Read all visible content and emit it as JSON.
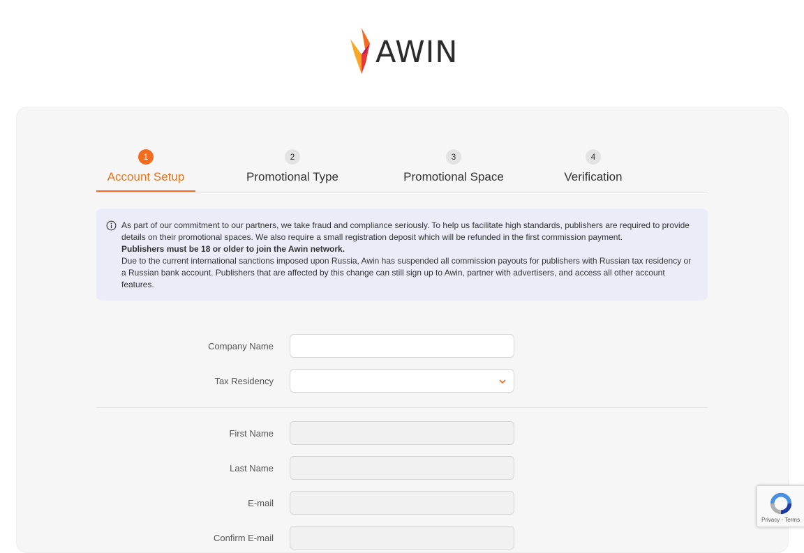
{
  "brand": {
    "name": "AWIN",
    "accent": "#f36d21"
  },
  "steps": [
    {
      "number": "1",
      "label": "Account Setup",
      "active": true
    },
    {
      "number": "2",
      "label": "Promotional Type",
      "active": false
    },
    {
      "number": "3",
      "label": "Promotional Space",
      "active": false
    },
    {
      "number": "4",
      "label": "Verification",
      "active": false
    }
  ],
  "notice": {
    "icon": "info-icon",
    "line1": "As part of our commitment to our partners, we take fraud and compliance seriously. To help us facilitate high standards, publishers are required to provide details on their promotional spaces. We also require a small registration deposit which will be refunded in the first commission payment.",
    "bold": "Publishers must be 18 or older to join the Awin network.",
    "line2": "Due to the current international sanctions imposed upon Russia, Awin has suspended all commission payouts for publishers with Russian tax residency or a Russian bank account. Publishers that are affected by this change can still sign up to Awin, partner with advertisers, and access all other account features."
  },
  "form": {
    "company_name": {
      "label": "Company Name",
      "value": ""
    },
    "tax_residency": {
      "label": "Tax Residency",
      "value": ""
    },
    "first_name": {
      "label": "First Name",
      "value": ""
    },
    "last_name": {
      "label": "Last Name",
      "value": ""
    },
    "email": {
      "label": "E-mail",
      "value": ""
    },
    "confirm_email": {
      "label": "Confirm E-mail",
      "value": ""
    }
  },
  "recaptcha": {
    "links": "Privacy - Terms"
  }
}
